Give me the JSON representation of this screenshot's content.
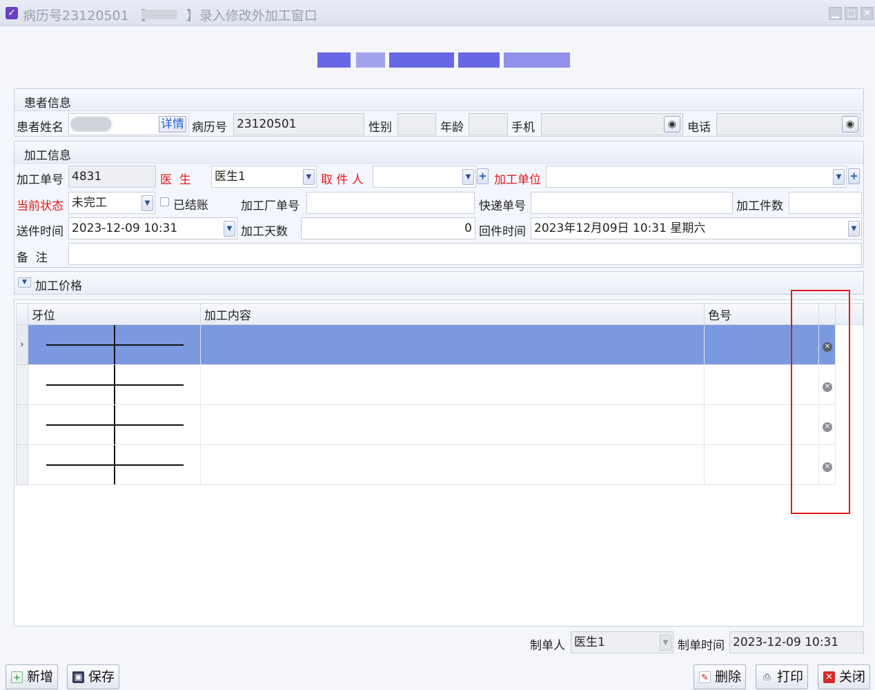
{
  "window": {
    "title": "病历号23120501 【",
    "title_suffix": "】录入修改外加工窗口",
    "min_glyph": "▁",
    "max_glyph": "□",
    "close_glyph": "✕"
  },
  "patient": {
    "section_title": "患者信息",
    "name_label": "患者姓名",
    "details_button": "详情",
    "record_label": "病历号",
    "record_value": "23120501",
    "gender_label": "性别",
    "gender_value": "",
    "age_label": "年龄",
    "age_value": "",
    "mobile_label": "手机",
    "mobile_value": "",
    "phone_label": "电话",
    "phone_value": ""
  },
  "processing": {
    "section_title": "加工信息",
    "order_no_label": "加工单号",
    "order_no_value": "4831",
    "doctor_label": "医  生",
    "doctor_value": "医生1",
    "pickup_label": "取 件 人",
    "pickup_value": "",
    "unit_label": "加工单位",
    "unit_value": "",
    "status_label": "当前状态",
    "status_value": "未完工",
    "settled_label": "已结账",
    "settled_checked": false,
    "factory_no_label": "加工厂单号",
    "factory_no_value": "",
    "express_label": "快递单号",
    "express_value": "",
    "count_label": "加工件数",
    "count_value": "",
    "send_time_label": "送件时间",
    "send_time_value": "2023-12-09 10:31",
    "days_label": "加工天数",
    "days_value": "0",
    "return_time_label": "回件时间",
    "return_time_value": "2023年12月09日 10:31 星期六",
    "remark_label": "备  注",
    "remark_value": ""
  },
  "price_section": {
    "title": "加工价格"
  },
  "grid": {
    "columns": [
      "牙位",
      "加工内容",
      "色号"
    ],
    "rows": [
      {
        "content": "",
        "color": ""
      },
      {
        "content": "",
        "color": ""
      },
      {
        "content": "",
        "color": ""
      },
      {
        "content": "",
        "color": ""
      }
    ],
    "selected_row_marker": "›",
    "delete_glyph": "✕"
  },
  "footer": {
    "creator_label": "制单人",
    "creator_value": "医生1",
    "created_time_label": "制单时间",
    "created_time_value": "2023-12-09 10:31"
  },
  "buttons": {
    "add": "新增",
    "save": "保存",
    "delete": "删除",
    "print": "打印",
    "close": "关闭"
  },
  "colors": {
    "selected_row": "#7b99df",
    "required_label": "#e61919",
    "highlight_box": "#e01a1a"
  }
}
